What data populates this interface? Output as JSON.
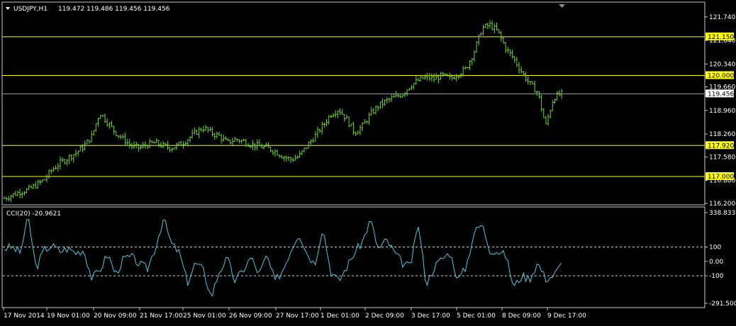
{
  "header": {
    "symbol": "USDJPY,H1",
    "ohlc": "119.472 119.486 119.456 119.456"
  },
  "colors": {
    "background": "#000000",
    "frame": "#c8c8c8",
    "candle": "#6fd12f",
    "hline": "#ffff00",
    "hline_label_bg": "#ffff00",
    "bid_line": "#a0a0a8",
    "cci": "#53c6dc",
    "text": "#ffffff"
  },
  "chart_data": [
    {
      "type": "line",
      "title": "USDJPY,H1",
      "series": [
        {
          "name": "",
          "values": [
            116.35,
            116.45,
            116.55,
            116.6,
            116.75,
            116.9,
            117.2,
            117.4,
            117.55,
            117.7,
            117.9,
            118.2,
            118.9,
            118.6,
            118.3,
            118.1,
            117.9,
            117.85,
            117.95,
            118.0,
            117.9,
            117.85,
            117.95,
            118.1,
            118.3,
            118.45,
            118.3,
            118.2,
            118.0,
            118.1,
            118.05,
            117.95,
            117.9,
            117.85,
            117.75,
            117.6,
            117.5,
            117.6,
            117.9,
            118.2,
            118.5,
            118.85,
            119.0,
            118.7,
            118.3,
            118.5,
            118.85,
            119.1,
            119.25,
            119.35,
            119.45,
            119.7,
            119.85,
            119.95,
            119.9,
            120.0,
            119.9,
            120.05,
            120.2,
            120.7,
            121.4,
            121.5,
            121.3,
            120.8,
            120.5,
            120.1,
            119.75,
            119.5,
            118.5,
            119.35,
            119.456
          ]
        }
      ],
      "ylim": [
        116.2,
        121.8
      ],
      "y_ticks": [
        "121.740",
        "121.040",
        "120.340",
        "119.660",
        "118.960",
        "118.260",
        "117.580",
        "116.880",
        "116.200"
      ],
      "horizontal_levels": [
        "121.150",
        "120.000",
        "117.920",
        "117.000"
      ],
      "current_price": "119.456",
      "grid": false
    },
    {
      "type": "line",
      "title": "CCI(20) -20.9621",
      "series": [
        {
          "name": "",
          "values": [
            90,
            100,
            60,
            310,
            -50,
            80,
            110,
            70,
            90,
            60,
            80,
            -120,
            -60,
            50,
            -90,
            20,
            30,
            -20,
            -50,
            100,
            300,
            120,
            60,
            -150,
            -10,
            -60,
            -250,
            -70,
            20,
            -140,
            -60,
            30,
            -90,
            40,
            -140,
            -60,
            80,
            200,
            60,
            -20,
            240,
            -70,
            -140,
            -40,
            60,
            140,
            290,
            80,
            150,
            60,
            -10,
            -40,
            260,
            -160,
            -40,
            20,
            60,
            -130,
            -40,
            200,
            260,
            80,
            70,
            40,
            -180,
            -100,
            -120,
            -10,
            -120,
            -100,
            -20
          ]
        }
      ],
      "ylim": [
        -291.5004,
        338.833
      ],
      "y_ticks": [
        "338.833",
        "100",
        "0.00",
        "-100",
        "-291.5004"
      ],
      "levels": [
        100,
        -100
      ],
      "grid": false
    }
  ],
  "x_labels": [
    "17 Nov 2014",
    "19 Nov 01:00",
    "20 Nov 09:00",
    "21 Nov 17:00",
    "25 Nov 01:00",
    "26 Nov 09:00",
    "27 Nov 17:00",
    "1 Dec 01:00",
    "2 Dec 09:00",
    "3 Dec 17:00",
    "5 Dec 01:00",
    "8 Dec 09:00",
    "9 Dec 17:00"
  ]
}
